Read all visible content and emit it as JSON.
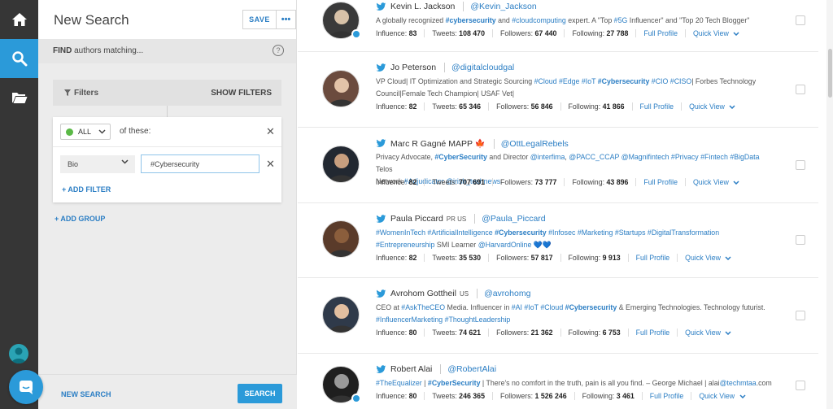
{
  "rail": {
    "items": [
      {
        "name": "home-icon",
        "active": false
      },
      {
        "name": "search-icon",
        "active": true
      },
      {
        "name": "folder-icon",
        "active": false
      }
    ]
  },
  "search_panel": {
    "title": "New Search",
    "save_label": "SAVE",
    "more_label": "•••",
    "close_label": "✕",
    "find_bold": "FIND",
    "find_rest": " authors matching...",
    "help_label": "?",
    "filters_label": "Filters",
    "show_filters_label": "SHOW FILTERS",
    "group": {
      "operator": "ALL",
      "of_these": "of these:",
      "field": "Bio",
      "value": "#Cybersecurity",
      "add_filter_label": "+ ADD FILTER"
    },
    "add_group_label": "+ ADD GROUP",
    "new_search_label": "NEW SEARCH",
    "search_label": "SEARCH"
  },
  "labels": {
    "influence": "Influence:",
    "tweets": "Tweets:",
    "followers": "Followers:",
    "following": "Following:",
    "full_profile": "Full Profile",
    "quick_view": "Quick View"
  },
  "results": [
    {
      "name": "Kevin L. Jackson",
      "suffix": "",
      "handle": "@Kevin_Jackson",
      "bio_line1": "A globally recognized #cybersecurity and #cloudcomputing expert. A \"Top #5G Influencer\" and \"Top 20 Tech Blogger\"",
      "bio_line2": "",
      "influence": "83",
      "tweets": "108 470",
      "followers": "67 440",
      "following": "27 788",
      "verified": true
    },
    {
      "name": "Jo Peterson",
      "suffix": "",
      "handle": "@digitalcloudgal",
      "bio_line1": "VP Cloud| IT Optimization and Strategic Sourcing #Cloud #Edge #IoT #Cybersecurity #CIO #CISO| Forbes Technology",
      "bio_line2": "Council|Female Tech Champion| USAF Vet|",
      "influence": "82",
      "tweets": "65 346",
      "followers": "56 846",
      "following": "41 866",
      "verified": false
    },
    {
      "name": "Marc R Gagné MAPP 🍁",
      "suffix": "",
      "handle": "@OttLegalRebels",
      "bio_line1": "Privacy Advocate, #CyberSecurity and Director @interfima, @PACC_CCAP @Magnifintech #Privacy #Fintech #BigData Telos",
      "bio_line2": "Network #Adjudicator @irish_technews",
      "influence": "82",
      "tweets": "707 691",
      "followers": "73 777",
      "following": "43 896",
      "verified": false
    },
    {
      "name": "Paula Piccard",
      "suffix": "PR US",
      "handle": "@Paula_Piccard",
      "bio_line1": "#WomenInTech #ArtificialIntelligence #Cybersecurity #Infosec #Marketing #Startups #DigitalTransformation",
      "bio_line2": "#Entrepreneurship SMI Learner @HarvardOnline 💙💙",
      "influence": "82",
      "tweets": "35 530",
      "followers": "57 817",
      "following": "9 913",
      "verified": false
    },
    {
      "name": "Avrohom Gottheil",
      "suffix": "US",
      "handle": "@avrohomg",
      "bio_line1": "CEO at #AskTheCEO Media. Influencer in #AI #IoT #Cloud #Cybersecurity & Emerging Technologies. Technology futurist.",
      "bio_line2": "#InfluencerMarketing #ThoughtLeadership",
      "influence": "80",
      "tweets": "74 621",
      "followers": "21 362",
      "following": "6 753",
      "verified": false
    },
    {
      "name": "Robert Alai",
      "suffix": "",
      "handle": "@RobertAlai",
      "bio_line1": "#TheEqualizer | #CyberSecurity | There's no comfort in the truth, pain is all you find. – George Michael | alai@techmtaa.com",
      "bio_line2": "",
      "influence": "80",
      "tweets": "246 365",
      "followers": "1 526 246",
      "following": "3 461",
      "verified": true
    }
  ],
  "colors": {
    "accent": "#2b9ad9",
    "link": "#2b7ec4",
    "rail": "#363636",
    "panel": "#ececec"
  }
}
